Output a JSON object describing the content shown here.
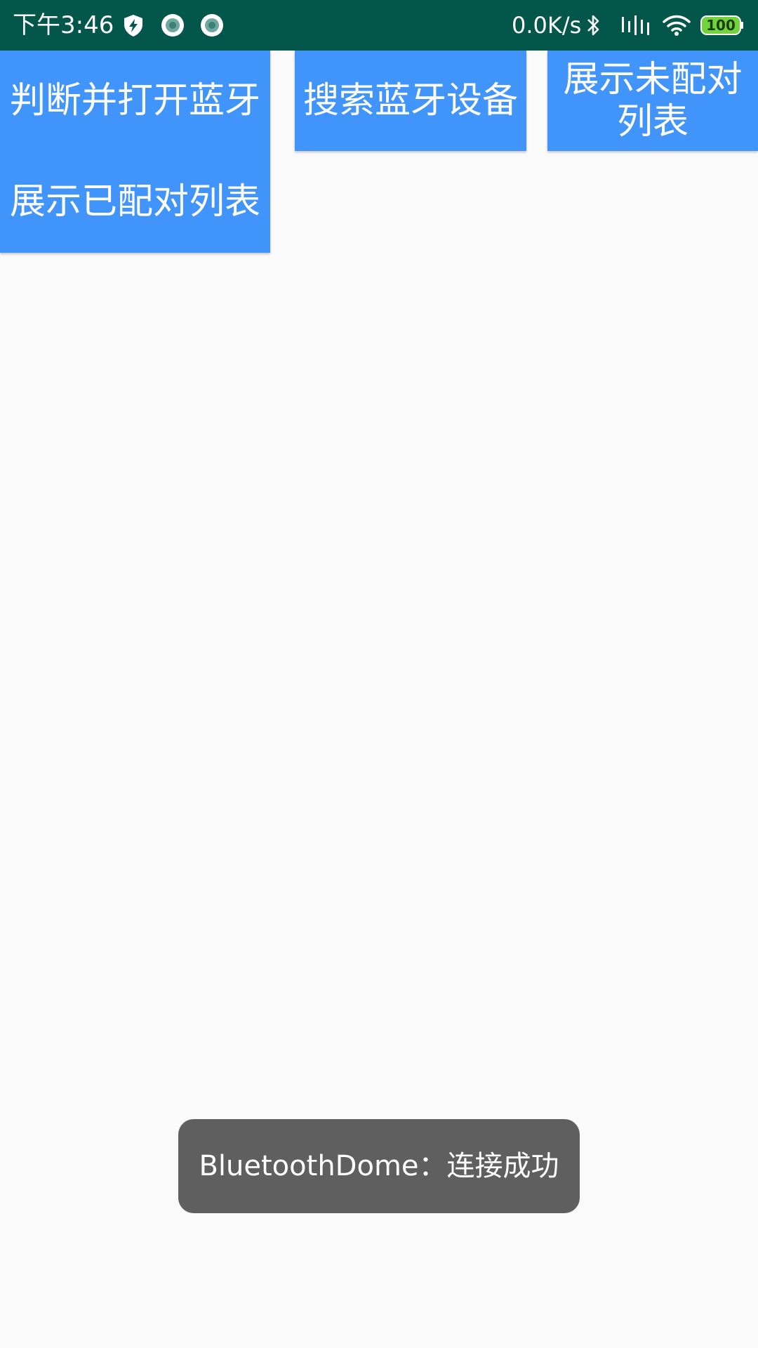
{
  "status_bar": {
    "time": "下午3:46",
    "net_speed": "0.0K/s",
    "battery_level": "100",
    "background_color": "#02574a",
    "icons": [
      "shield-bolt-icon",
      "notification-dot-icon",
      "notification-dot-icon",
      "bluetooth-icon",
      "signal-icon",
      "wifi-icon",
      "battery-icon"
    ]
  },
  "buttons": {
    "open_bluetooth": "判断并打开蓝牙",
    "search_devices": "搜索蓝牙设备",
    "show_unpaired": "展示未配对列表",
    "show_paired": "展示已配对列表",
    "color": "#4194fa"
  },
  "toast": {
    "message": "BluetoothDome：连接成功"
  }
}
